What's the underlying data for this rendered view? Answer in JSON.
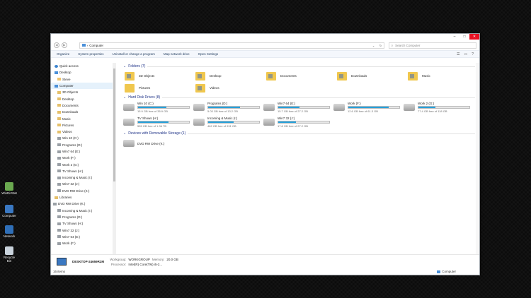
{
  "desktop": {
    "icons": [
      {
        "label": "WinDirStat"
      },
      {
        "label": "Computer"
      },
      {
        "label": "Network"
      },
      {
        "label": "Recycle Bin"
      }
    ]
  },
  "window": {
    "address": "Computer",
    "search_placeholder": "Search Computer"
  },
  "toolbar": {
    "items": [
      "Organize",
      "System properties",
      "Uninstall or change a program",
      "Map network drive",
      "Open Settings"
    ]
  },
  "sidebar": {
    "items": [
      {
        "label": "Quick access",
        "icon": "star-icon"
      },
      {
        "label": "Desktop",
        "icon": "desktop-icon"
      },
      {
        "label": "Steve",
        "icon": "user-folder-icon"
      },
      {
        "label": "Computer",
        "icon": "computer-icon"
      },
      {
        "label": "3D Objects",
        "icon": "folder-icon"
      },
      {
        "label": "Desktop",
        "icon": "folder-icon"
      },
      {
        "label": "Documents",
        "icon": "folder-icon"
      },
      {
        "label": "Downloads",
        "icon": "folder-icon"
      },
      {
        "label": "Music",
        "icon": "folder-icon"
      },
      {
        "label": "Pictures",
        "icon": "folder-icon"
      },
      {
        "label": "Videos",
        "icon": "folder-icon"
      },
      {
        "label": "Win 10 (C:)",
        "icon": "drive-icon"
      },
      {
        "label": "Programs (D:)",
        "icon": "drive-icon"
      },
      {
        "label": "Win7 64 (E:)",
        "icon": "drive-icon"
      },
      {
        "label": "Work (F:)",
        "icon": "drive-icon"
      },
      {
        "label": "Work 2 (G:)",
        "icon": "drive-icon"
      },
      {
        "label": "TV Shows (H:)",
        "icon": "drive-icon"
      },
      {
        "label": "Incoming & Music (I:)",
        "icon": "drive-icon"
      },
      {
        "label": "Win7 32 (J:)",
        "icon": "drive-icon"
      },
      {
        "label": "DVD RW Drive (K:)",
        "icon": "drive-icon"
      },
      {
        "label": "Libraries",
        "icon": "folder-icon"
      },
      {
        "label": "DVD RW Drive (K:)",
        "icon": "drive-icon"
      },
      {
        "label": "Incoming & Music (I:)",
        "icon": "drive-icon"
      },
      {
        "label": "Programs (D:)",
        "icon": "drive-icon"
      },
      {
        "label": "TV Shows (H:)",
        "icon": "drive-icon"
      },
      {
        "label": "Win7 32 (J:)",
        "icon": "drive-icon"
      },
      {
        "label": "Win7 64 (E:)",
        "icon": "drive-icon"
      },
      {
        "label": "Work (F:)",
        "icon": "drive-icon"
      }
    ]
  },
  "sections": {
    "folders": "Folders (7)",
    "drives": "Hard Disk Drives (8)",
    "removable": "Devices with Removable Storage (1)"
  },
  "folders": [
    {
      "label": "3D Objects"
    },
    {
      "label": "Desktop"
    },
    {
      "label": "Documents"
    },
    {
      "label": "Downloads"
    },
    {
      "label": "Music"
    },
    {
      "label": "Pictures"
    },
    {
      "label": "Videos"
    }
  ],
  "drives": [
    {
      "label": "Win 10 (C:)",
      "free": "15.9 GB free of 35.9 GB",
      "used_fraction": 0.56
    },
    {
      "label": "Programs (D:)",
      "free": "5.03 GB free of 13.2 GB",
      "used_fraction": 0.62
    },
    {
      "label": "Win7 64 (E:)",
      "free": "15.7 GB free of 27.2 GB",
      "used_fraction": 0.42
    },
    {
      "label": "Work (F:)",
      "free": "12.6 GB free of 61.3 GB",
      "used_fraction": 0.79
    },
    {
      "label": "Work 2 (G:)",
      "free": "77.4 GB free of 118 GB",
      "used_fraction": 0.34
    },
    {
      "label": "TV Shows (H:)",
      "free": "555 GB free of 1.36 TB",
      "used_fraction": 0.6
    },
    {
      "label": "Incoming & Music (I:)",
      "free": "462 GB free of 931 GB",
      "used_fraction": 0.5
    },
    {
      "label": "Win7 32 (J:)",
      "free": "17.8 GB free of 27.2 GB",
      "used_fraction": 0.35
    }
  ],
  "removable": [
    {
      "label": "DVD RW Drive (K:)"
    }
  ],
  "details": {
    "name": "DESKTOP-24659R2M",
    "workgroup_label": "Workgroup:",
    "workgroup": "WORKGROUP",
    "memory_label": "Memory:",
    "memory": "20.0 GB",
    "processor_label": "Processor:",
    "processor": "Intel(R) Core(TM) i5-2..."
  },
  "status": {
    "items_count": "16 items",
    "location": "Computer"
  },
  "colors": {
    "accent": "#26a0da",
    "folder": "#f0c74e",
    "close": "#e81123"
  }
}
